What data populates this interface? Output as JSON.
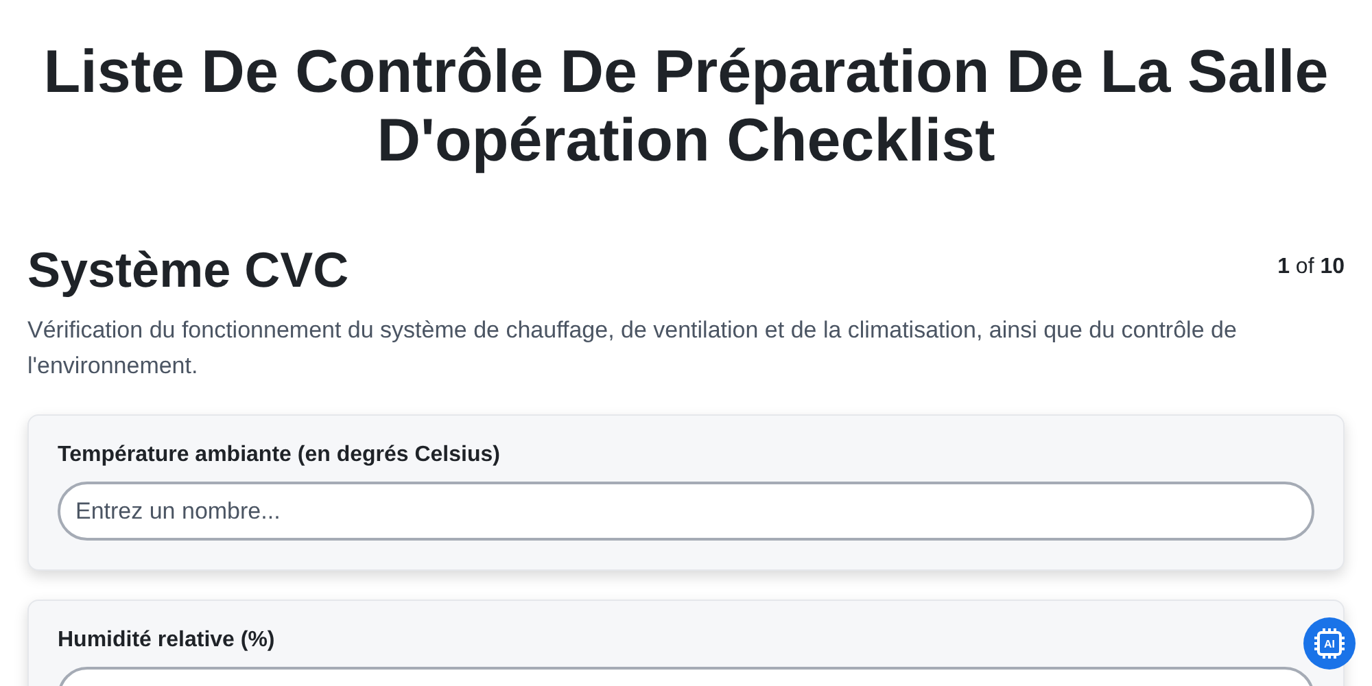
{
  "title": "Liste De Contrôle De Préparation De La Salle D'opération Checklist",
  "section": {
    "heading": "Système CVC",
    "counter": "**1** of **10**",
    "description": "Vérification du fonctionnement du système de chauffage, de ventilation et de la climatisation, ainsi que du contrôle de l'environnement."
  },
  "fields": [
    {
      "label": "Température ambiante (en degrés Celsius)",
      "placeholder": "Entrez un nombre..."
    },
    {
      "label": "Humidité relative (%)"
    }
  ],
  "assistant_button": {
    "label": "AI"
  }
}
